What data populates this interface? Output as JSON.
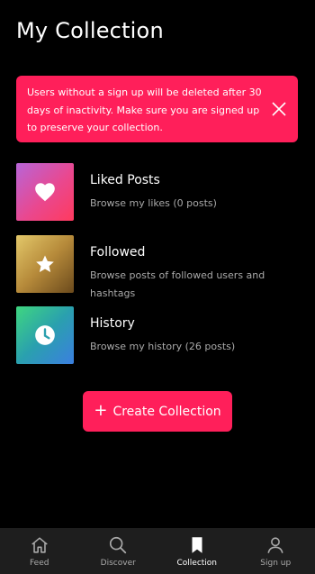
{
  "page": {
    "title": "My Collection"
  },
  "banner": {
    "message": "Users without a sign up will be deleted after 30 days of inactivity.  Make sure you are signed up to preserve your collection.",
    "close_icon": "close-icon",
    "color": "#ff1f5a"
  },
  "collections": [
    {
      "title": "Liked Posts",
      "description": "Browse my likes (0 posts)",
      "icon": "heart-icon"
    },
    {
      "title": "Followed",
      "description": "Browse posts of followed users and hashtags",
      "icon": "star-icon"
    },
    {
      "title": "History",
      "description": "Browse my history (26 posts)",
      "icon": "clock-icon"
    }
  ],
  "create_button": {
    "plus": "+",
    "label": "Create Collection"
  },
  "nav": {
    "items": [
      {
        "label": "Feed",
        "icon": "home-icon"
      },
      {
        "label": "Discover",
        "icon": "search-icon"
      },
      {
        "label": "Collection",
        "icon": "bookmark-icon",
        "active": true
      },
      {
        "label": "Sign up",
        "icon": "user-icon"
      }
    ]
  }
}
